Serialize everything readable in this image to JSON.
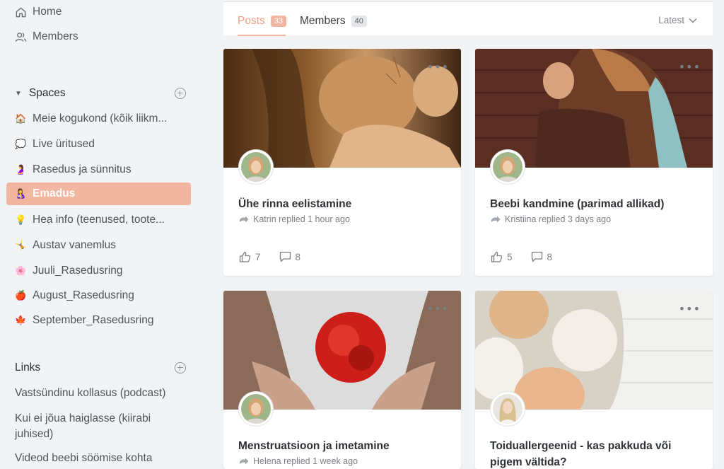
{
  "sidebar": {
    "nav": {
      "home": "Home",
      "members": "Members"
    },
    "spaces_title": "Spaces",
    "spaces": [
      {
        "emoji": "🏠",
        "label": "Meie kogukond (kõik liikm..."
      },
      {
        "emoji": "💭",
        "label": "Live üritused"
      },
      {
        "emoji": "🤰",
        "label": "Rasedus ja sünnitus"
      },
      {
        "emoji": "🤱",
        "label": "Emadus"
      },
      {
        "emoji": "💡",
        "label": "Hea info (teenused, toote..."
      },
      {
        "emoji": "🤸",
        "label": "Austav vanemlus"
      },
      {
        "emoji": "🌸",
        "label": "Juuli_Rasedusring"
      },
      {
        "emoji": "🍎",
        "label": "August_Rasedusring"
      },
      {
        "emoji": "🍁",
        "label": "September_Rasedusring"
      }
    ],
    "active_space": "Emadus",
    "links_title": "Links",
    "links": [
      "Vastsündinu kollasus (podcast)",
      "Kui ei jõua haiglasse (kiirabi juhised)",
      "Videod beebi söömise kohta"
    ]
  },
  "tabs": {
    "posts_label": "Posts",
    "posts_count": "33",
    "members_label": "Members",
    "members_count": "40",
    "sort_label": "Latest"
  },
  "posts": [
    {
      "title": "Ühe rinna eelistamine",
      "meta": "Katrin replied 1 hour ago",
      "likes": "7",
      "comments": "8"
    },
    {
      "title": "Beebi kandmine (parimad allikad)",
      "meta": "Kristiina replied 3 days ago",
      "likes": "5",
      "comments": "8"
    },
    {
      "title": "Menstruatsioon ja imetamine",
      "meta": "Helena replied 1 week ago",
      "likes": "",
      "comments": ""
    },
    {
      "title": "Toiduallergeenid - kas pakkuda või pigem vältida?",
      "meta": "",
      "likes": "",
      "comments": ""
    }
  ],
  "colors": {
    "accent": "#f0b6a0",
    "accent_text": "#e9a085",
    "background": "#f2f3f5"
  }
}
